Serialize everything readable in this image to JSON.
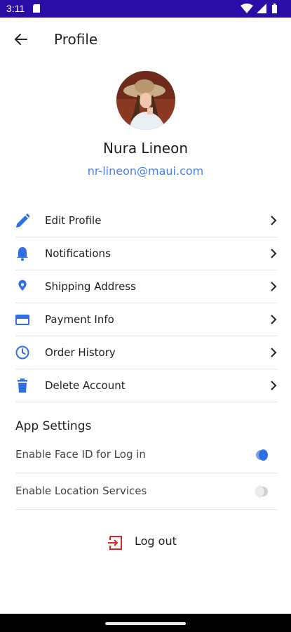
{
  "status_bar": {
    "time": "3:11",
    "color": "#2b0ea8",
    "icons": [
      "sd-card-icon",
      "wifi-icon",
      "signal-icon",
      "battery-icon"
    ]
  },
  "header": {
    "title": "Profile",
    "back_icon": "arrow-left-icon"
  },
  "profile": {
    "name": "Nura Lineon",
    "email": "nr-lineon@maui.com",
    "email_color": "#4a7fe6"
  },
  "menu": {
    "items": [
      {
        "label": "Edit Profile",
        "icon": "pencil-icon"
      },
      {
        "label": "Notifications",
        "icon": "bell-icon"
      },
      {
        "label": "Shipping Address",
        "icon": "map-pin-icon"
      },
      {
        "label": "Payment Info",
        "icon": "credit-card-icon"
      },
      {
        "label": "Order History",
        "icon": "clock-icon"
      },
      {
        "label": "Delete Account",
        "icon": "trash-icon"
      }
    ],
    "icon_color": "#2f6fe4"
  },
  "app_settings": {
    "title": "App Settings",
    "items": [
      {
        "label": "Enable Face ID for Log in",
        "enabled": true
      },
      {
        "label": "Enable Location Services",
        "enabled": false
      }
    ]
  },
  "logout": {
    "label": "Log out",
    "icon": "logout-icon",
    "icon_color": "#e02424"
  }
}
